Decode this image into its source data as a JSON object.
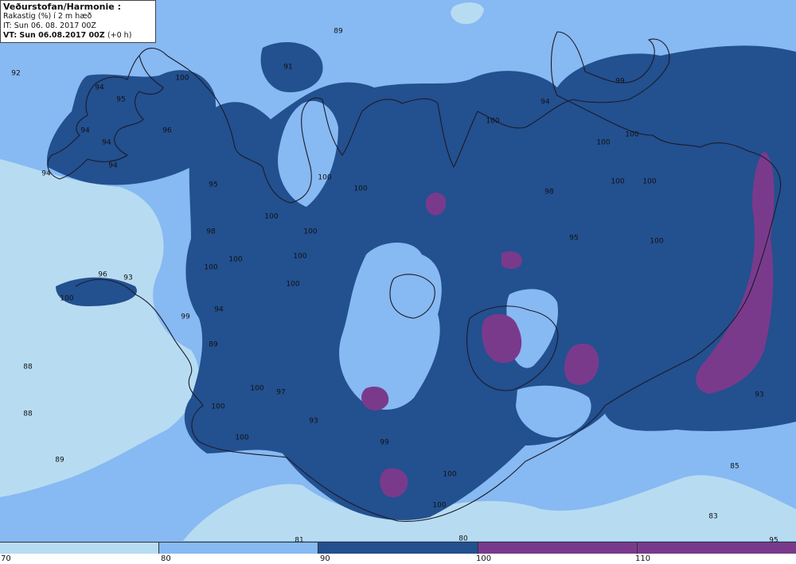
{
  "header": {
    "title": "Veðurstofan/Harmonie :",
    "parameter": "Rakastig (%) í 2 m hæð",
    "initial_time": "IT: Sun 06. 08. 2017 00Z",
    "valid_time": "VT: Sun 06.08.2017 00Z",
    "valid_offset": "(+0 h)"
  },
  "colors": {
    "band_70_80": "#b7dcf1",
    "band_80_90": "#87b9f2",
    "band_90_100": "#23508f",
    "band_100_110": "#7a3a8c",
    "coastline": "#1b1b2a"
  },
  "colorbar": {
    "ticks": [
      "70",
      "80",
      "90",
      "100",
      "110"
    ],
    "bands": [
      {
        "range": "70-80",
        "color": "#b7dcf1"
      },
      {
        "range": "80-90",
        "color": "#87b9f2"
      },
      {
        "range": "90-100",
        "color": "#23508f"
      },
      {
        "range": "100-110",
        "color": "#7a3a8c"
      },
      {
        "range": ">110",
        "color": "#7a3a8c"
      }
    ]
  },
  "field_values": [
    "89",
    "92",
    "94",
    "95",
    "100",
    "91",
    "94",
    "96",
    "94",
    "94",
    "94",
    "95",
    "100",
    "100",
    "100",
    "98",
    "100",
    "100",
    "100",
    "100",
    "96",
    "93",
    "100",
    "94",
    "99",
    "89",
    "88",
    "88",
    "89",
    "100",
    "97",
    "100",
    "100",
    "93",
    "99",
    "100",
    "100",
    "80",
    "81",
    "100",
    "94",
    "99",
    "100",
    "100",
    "100",
    "100",
    "100",
    "98",
    "95",
    "100",
    "93",
    "85",
    "83",
    "95"
  ]
}
